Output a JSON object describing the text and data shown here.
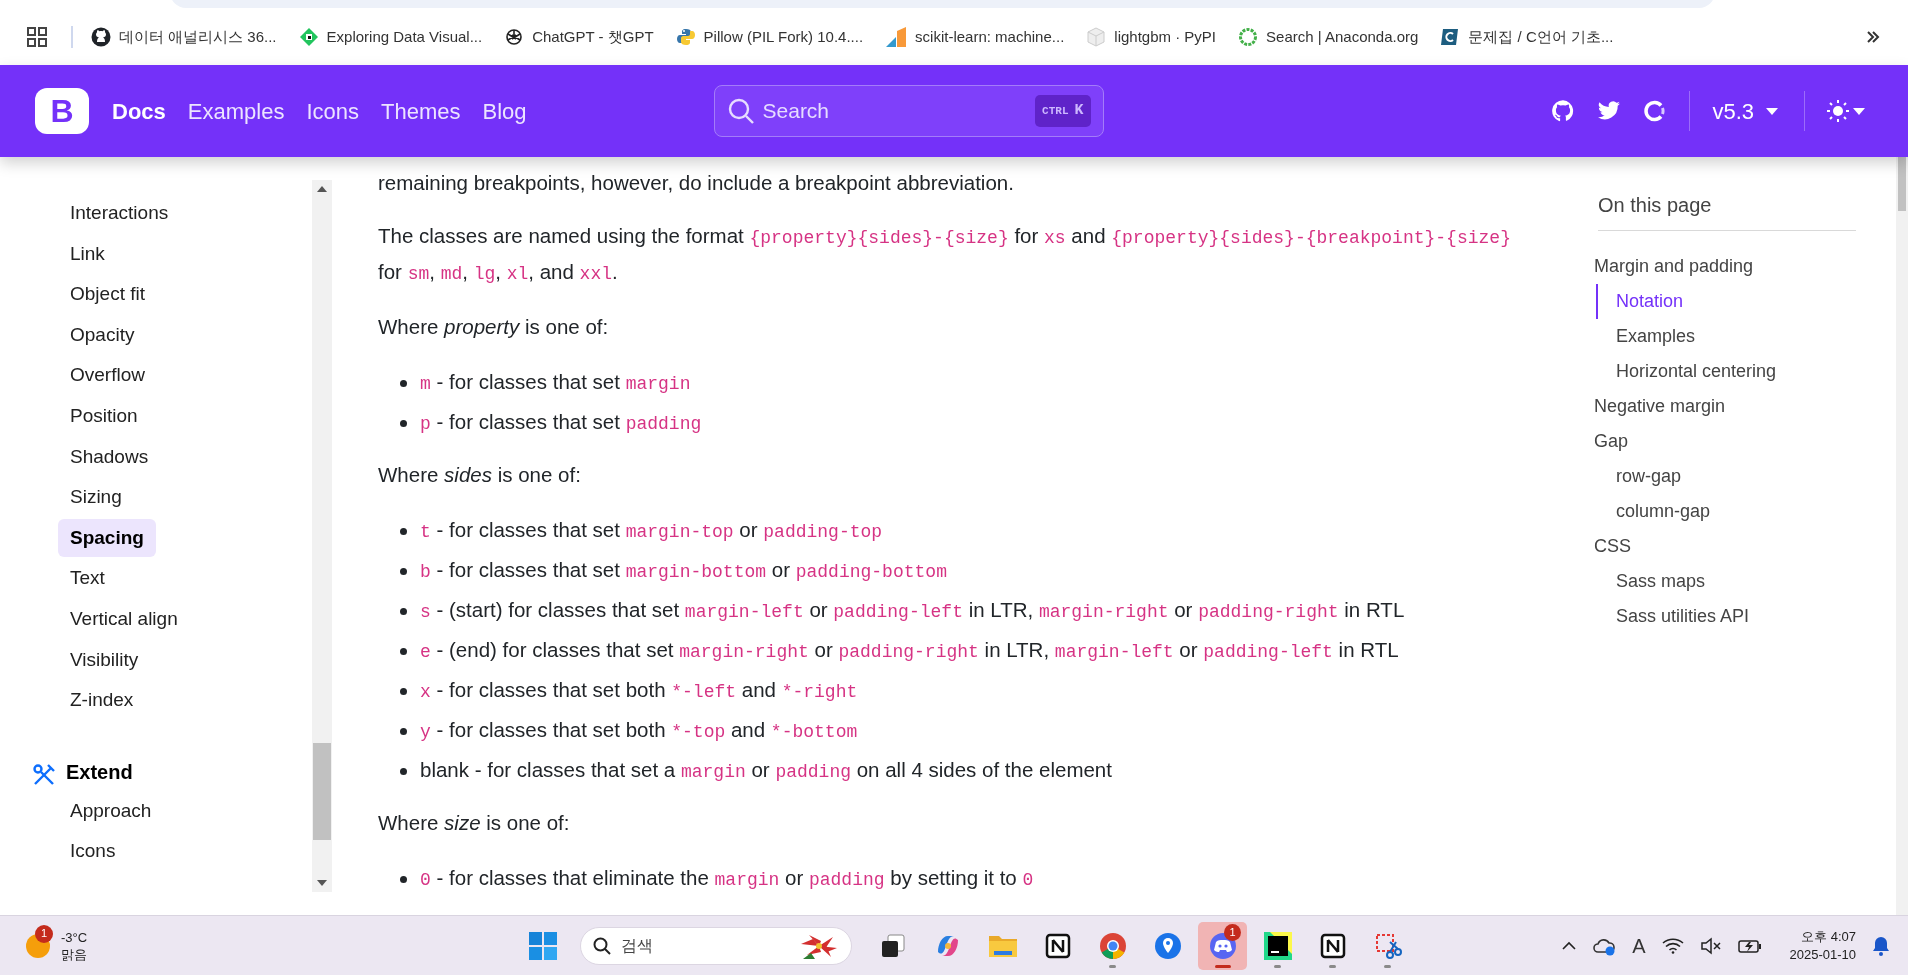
{
  "bookmarks": [
    {
      "kind": "github",
      "title": "데이터 애널리시스 36..."
    },
    {
      "kind": "diamond",
      "title": "Exploring Data Visual..."
    },
    {
      "kind": "knot",
      "title": "ChatGPT - 챗GPT"
    },
    {
      "kind": "python",
      "title": "Pillow (PIL Fork) 10.4...."
    },
    {
      "kind": "sklearn",
      "title": "scikit-learn: machine..."
    },
    {
      "kind": "cube",
      "title": "lightgbm · PyPI"
    },
    {
      "kind": "ring",
      "title": "Search | Anaconda.org"
    },
    {
      "kind": "tile",
      "title": "문제집 / C언어 기초..."
    }
  ],
  "navbar": {
    "logo": "B",
    "links": [
      {
        "label": "Docs",
        "selected": true
      },
      {
        "label": "Examples",
        "selected": false
      },
      {
        "label": "Icons",
        "selected": false
      },
      {
        "label": "Themes",
        "selected": false
      },
      {
        "label": "Blog",
        "selected": false
      }
    ],
    "search": {
      "placeholder": "Search",
      "keys": [
        "CTRL",
        "K"
      ]
    },
    "version": "v5.3"
  },
  "sidebar": {
    "items": [
      {
        "label": "Interactions",
        "selected": false
      },
      {
        "label": "Link",
        "selected": false
      },
      {
        "label": "Object fit",
        "selected": false
      },
      {
        "label": "Opacity",
        "selected": false
      },
      {
        "label": "Overflow",
        "selected": false
      },
      {
        "label": "Position",
        "selected": false
      },
      {
        "label": "Shadows",
        "selected": false
      },
      {
        "label": "Sizing",
        "selected": false
      },
      {
        "label": "Spacing",
        "selected": true
      },
      {
        "label": "Text",
        "selected": false
      },
      {
        "label": "Vertical align",
        "selected": false
      },
      {
        "label": "Visibility",
        "selected": false
      },
      {
        "label": "Z-index",
        "selected": false
      }
    ],
    "section": {
      "title": "Extend",
      "items": [
        {
          "label": "Approach",
          "selected": false
        },
        {
          "label": "Icons",
          "selected": false
        }
      ]
    }
  },
  "content": [
    {
      "kind": "p",
      "segments": [
        {
          "kind": "text",
          "text": "remaining breakpoints, however, do include a breakpoint abbreviation."
        }
      ]
    },
    {
      "kind": "p",
      "segments": [
        {
          "kind": "text",
          "text": "The classes are named using the format "
        },
        {
          "kind": "code",
          "text": "{property}{sides}-{size}"
        },
        {
          "kind": "text",
          "text": " for "
        },
        {
          "kind": "code",
          "text": "xs"
        },
        {
          "kind": "text",
          "text": " and "
        },
        {
          "kind": "code",
          "text": "{property}{sides}-{breakpoint}-{size}"
        },
        {
          "kind": "text",
          "text": " for "
        },
        {
          "kind": "code",
          "text": "sm"
        },
        {
          "kind": "text",
          "text": ", "
        },
        {
          "kind": "code",
          "text": "md"
        },
        {
          "kind": "text",
          "text": ", "
        },
        {
          "kind": "code",
          "text": "lg"
        },
        {
          "kind": "text",
          "text": ", "
        },
        {
          "kind": "code",
          "text": "xl"
        },
        {
          "kind": "text",
          "text": ", and "
        },
        {
          "kind": "code",
          "text": "xxl"
        },
        {
          "kind": "text",
          "text": "."
        }
      ]
    },
    {
      "kind": "p",
      "segments": [
        {
          "kind": "text",
          "text": "Where "
        },
        {
          "kind": "em",
          "text": "property"
        },
        {
          "kind": "text",
          "text": " is one of:"
        }
      ]
    },
    {
      "kind": "list",
      "items": [
        [
          {
            "kind": "code",
            "text": "m"
          },
          {
            "kind": "text",
            "text": " - for classes that set "
          },
          {
            "kind": "code",
            "text": "margin"
          }
        ],
        [
          {
            "kind": "code",
            "text": "p"
          },
          {
            "kind": "text",
            "text": " - for classes that set "
          },
          {
            "kind": "code",
            "text": "padding"
          }
        ]
      ]
    },
    {
      "kind": "p",
      "segments": [
        {
          "kind": "text",
          "text": "Where "
        },
        {
          "kind": "em",
          "text": "sides"
        },
        {
          "kind": "text",
          "text": " is one of:"
        }
      ]
    },
    {
      "kind": "list",
      "items": [
        [
          {
            "kind": "code",
            "text": "t"
          },
          {
            "kind": "text",
            "text": " - for classes that set "
          },
          {
            "kind": "code",
            "text": "margin-top"
          },
          {
            "kind": "text",
            "text": " or "
          },
          {
            "kind": "code",
            "text": "padding-top"
          }
        ],
        [
          {
            "kind": "code",
            "text": "b"
          },
          {
            "kind": "text",
            "text": " - for classes that set "
          },
          {
            "kind": "code",
            "text": "margin-bottom"
          },
          {
            "kind": "text",
            "text": " or "
          },
          {
            "kind": "code",
            "text": "padding-bottom"
          }
        ],
        [
          {
            "kind": "code",
            "text": "s"
          },
          {
            "kind": "text",
            "text": " - (start) for classes that set "
          },
          {
            "kind": "code",
            "text": "margin-left"
          },
          {
            "kind": "text",
            "text": " or "
          },
          {
            "kind": "code",
            "text": "padding-left"
          },
          {
            "kind": "text",
            "text": " in LTR, "
          },
          {
            "kind": "code",
            "text": "margin-right"
          },
          {
            "kind": "text",
            "text": " or "
          },
          {
            "kind": "code",
            "text": "padding-right"
          },
          {
            "kind": "text",
            "text": " in RTL"
          }
        ],
        [
          {
            "kind": "code",
            "text": "e"
          },
          {
            "kind": "text",
            "text": " - (end) for classes that set "
          },
          {
            "kind": "code",
            "text": "margin-right"
          },
          {
            "kind": "text",
            "text": " or "
          },
          {
            "kind": "code",
            "text": "padding-right"
          },
          {
            "kind": "text",
            "text": " in LTR, "
          },
          {
            "kind": "code",
            "text": "margin-left"
          },
          {
            "kind": "text",
            "text": " or "
          },
          {
            "kind": "code",
            "text": "padding-left"
          },
          {
            "kind": "text",
            "text": " in RTL"
          }
        ],
        [
          {
            "kind": "code",
            "text": "x"
          },
          {
            "kind": "text",
            "text": " - for classes that set both "
          },
          {
            "kind": "code",
            "text": "*-left"
          },
          {
            "kind": "text",
            "text": " and "
          },
          {
            "kind": "code",
            "text": "*-right"
          }
        ],
        [
          {
            "kind": "code",
            "text": "y"
          },
          {
            "kind": "text",
            "text": " - for classes that set both "
          },
          {
            "kind": "code",
            "text": "*-top"
          },
          {
            "kind": "text",
            "text": " and "
          },
          {
            "kind": "code",
            "text": "*-bottom"
          }
        ],
        [
          {
            "kind": "text",
            "text": "blank - for classes that set a "
          },
          {
            "kind": "code",
            "text": "margin"
          },
          {
            "kind": "text",
            "text": " or "
          },
          {
            "kind": "code",
            "text": "padding"
          },
          {
            "kind": "text",
            "text": " on all 4 sides of the element"
          }
        ]
      ]
    },
    {
      "kind": "p",
      "segments": [
        {
          "kind": "text",
          "text": "Where "
        },
        {
          "kind": "em",
          "text": "size"
        },
        {
          "kind": "text",
          "text": " is one of:"
        }
      ]
    },
    {
      "kind": "list",
      "items": [
        [
          {
            "kind": "code",
            "text": "0"
          },
          {
            "kind": "text",
            "text": " - for classes that eliminate the "
          },
          {
            "kind": "code",
            "text": "margin"
          },
          {
            "kind": "text",
            "text": " or "
          },
          {
            "kind": "code",
            "text": "padding"
          },
          {
            "kind": "text",
            "text": " by setting it to "
          },
          {
            "kind": "code",
            "text": "0"
          }
        ]
      ]
    }
  ],
  "toc": {
    "title": "On this page",
    "items": [
      {
        "label": "Margin and padding",
        "selected": false,
        "children": [
          {
            "label": "Notation",
            "selected": true
          },
          {
            "label": "Examples",
            "selected": false
          },
          {
            "label": "Horizontal centering",
            "selected": false
          }
        ]
      },
      {
        "label": "Negative margin",
        "selected": false
      },
      {
        "label": "Gap",
        "selected": false,
        "children": [
          {
            "label": "row-gap",
            "selected": false
          },
          {
            "label": "column-gap",
            "selected": false
          }
        ]
      },
      {
        "label": "CSS",
        "selected": false,
        "children": [
          {
            "label": "Sass maps",
            "selected": false
          },
          {
            "label": "Sass utilities API",
            "selected": false
          }
        ]
      }
    ]
  },
  "taskbar": {
    "weather": {
      "badge": "1",
      "temperature": "-3°C",
      "condition": "맑음"
    },
    "search": {
      "placeholder": "검색"
    },
    "apps": [
      {
        "kind": "taskview",
        "running": false,
        "active": false
      },
      {
        "kind": "copilot",
        "running": false,
        "active": false
      },
      {
        "kind": "folder",
        "running": false,
        "active": false
      },
      {
        "kind": "notebook",
        "running": false,
        "active": false
      },
      {
        "kind": "chrome",
        "running": true,
        "active": false
      },
      {
        "kind": "pin",
        "running": false,
        "active": false
      },
      {
        "kind": "discord",
        "running": true,
        "active": true,
        "badge": "1"
      },
      {
        "kind": "ide",
        "running": true,
        "active": false
      },
      {
        "kind": "notebook",
        "running": true,
        "active": false
      },
      {
        "kind": "scissors",
        "running": true,
        "active": false
      }
    ],
    "ime": "A",
    "time": "오후 4:07",
    "date": "2025-01-10"
  }
}
